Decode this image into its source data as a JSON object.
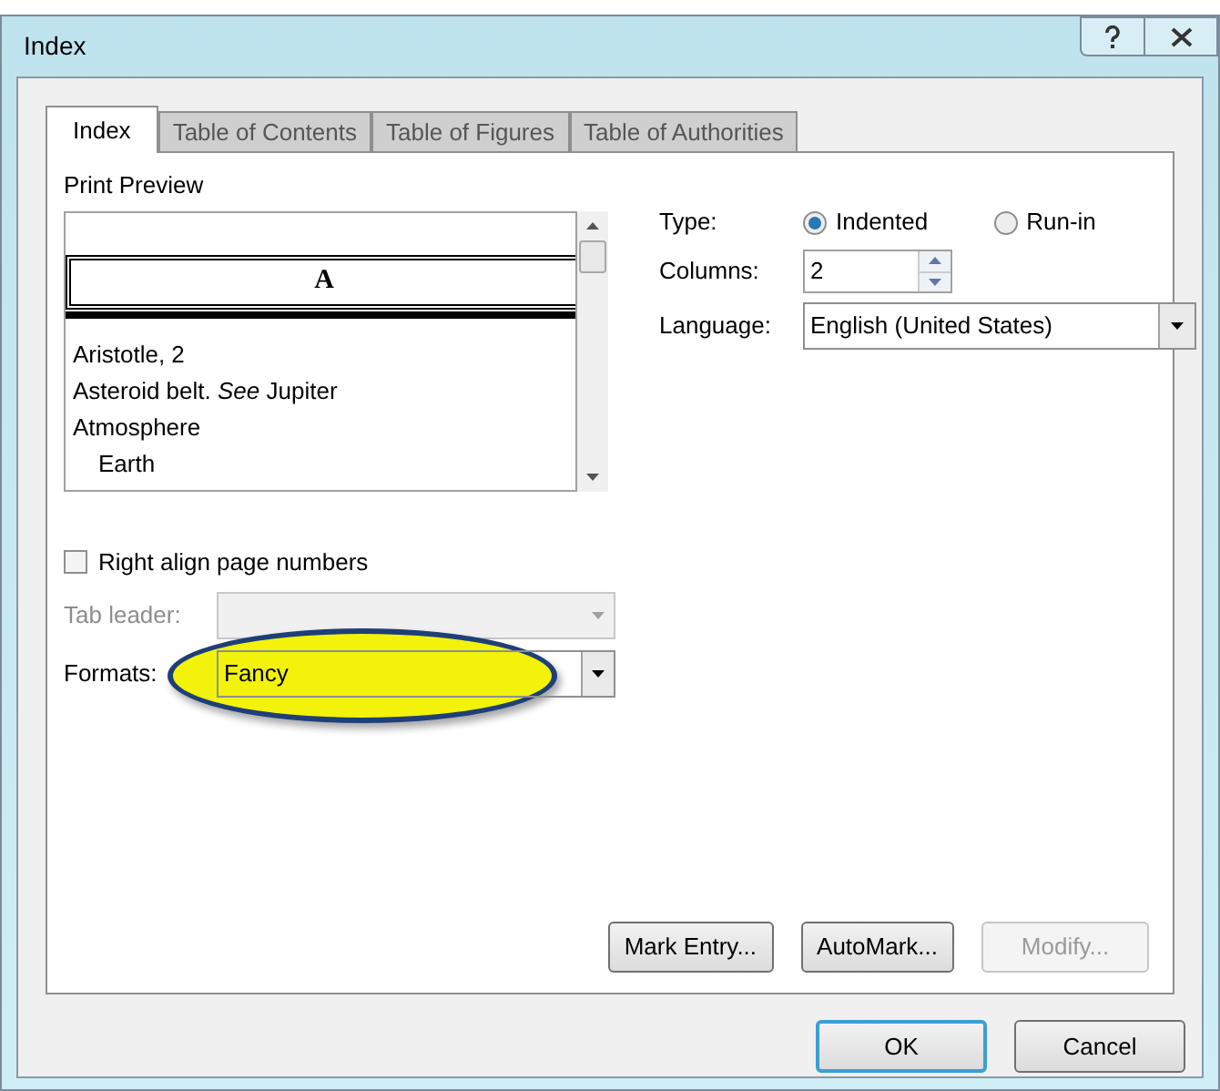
{
  "window": {
    "title": "Index"
  },
  "tabs": [
    {
      "label": "Index",
      "selected": true
    },
    {
      "label": "Table of Contents",
      "selected": false
    },
    {
      "label": "Table of Figures",
      "selected": false
    },
    {
      "label": "Table of Authorities",
      "selected": false
    }
  ],
  "print_preview": {
    "label": "Print Preview",
    "heading": "A",
    "entries": [
      {
        "text": "Aristotle, 2"
      },
      {
        "text": "Asteroid belt. *See* Jupiter"
      },
      {
        "text": "Atmosphere",
        "children": [
          {
            "text": "Earth"
          }
        ]
      }
    ]
  },
  "right_align": {
    "label": "Right align page numbers",
    "checked": false
  },
  "tab_leader": {
    "label": "Tab leader:",
    "disabled": true
  },
  "formats": {
    "label": "Formats:",
    "value": "Fancy",
    "highlighted": true
  },
  "type": {
    "label": "Type:",
    "options": [
      {
        "label": "Indented",
        "selected": true
      },
      {
        "label": "Run-in",
        "selected": false
      }
    ]
  },
  "columns": {
    "label": "Columns:",
    "value": "2"
  },
  "language": {
    "label": "Language:",
    "value": "English (United States)"
  },
  "tab_buttons": [
    {
      "label": "Mark Entry...",
      "disabled": false
    },
    {
      "label": "AutoMark...",
      "disabled": false
    },
    {
      "label": "Modify...",
      "disabled": true
    }
  ],
  "dialog_buttons": [
    {
      "label": "OK",
      "default": true
    },
    {
      "label": "Cancel",
      "default": false
    }
  ]
}
